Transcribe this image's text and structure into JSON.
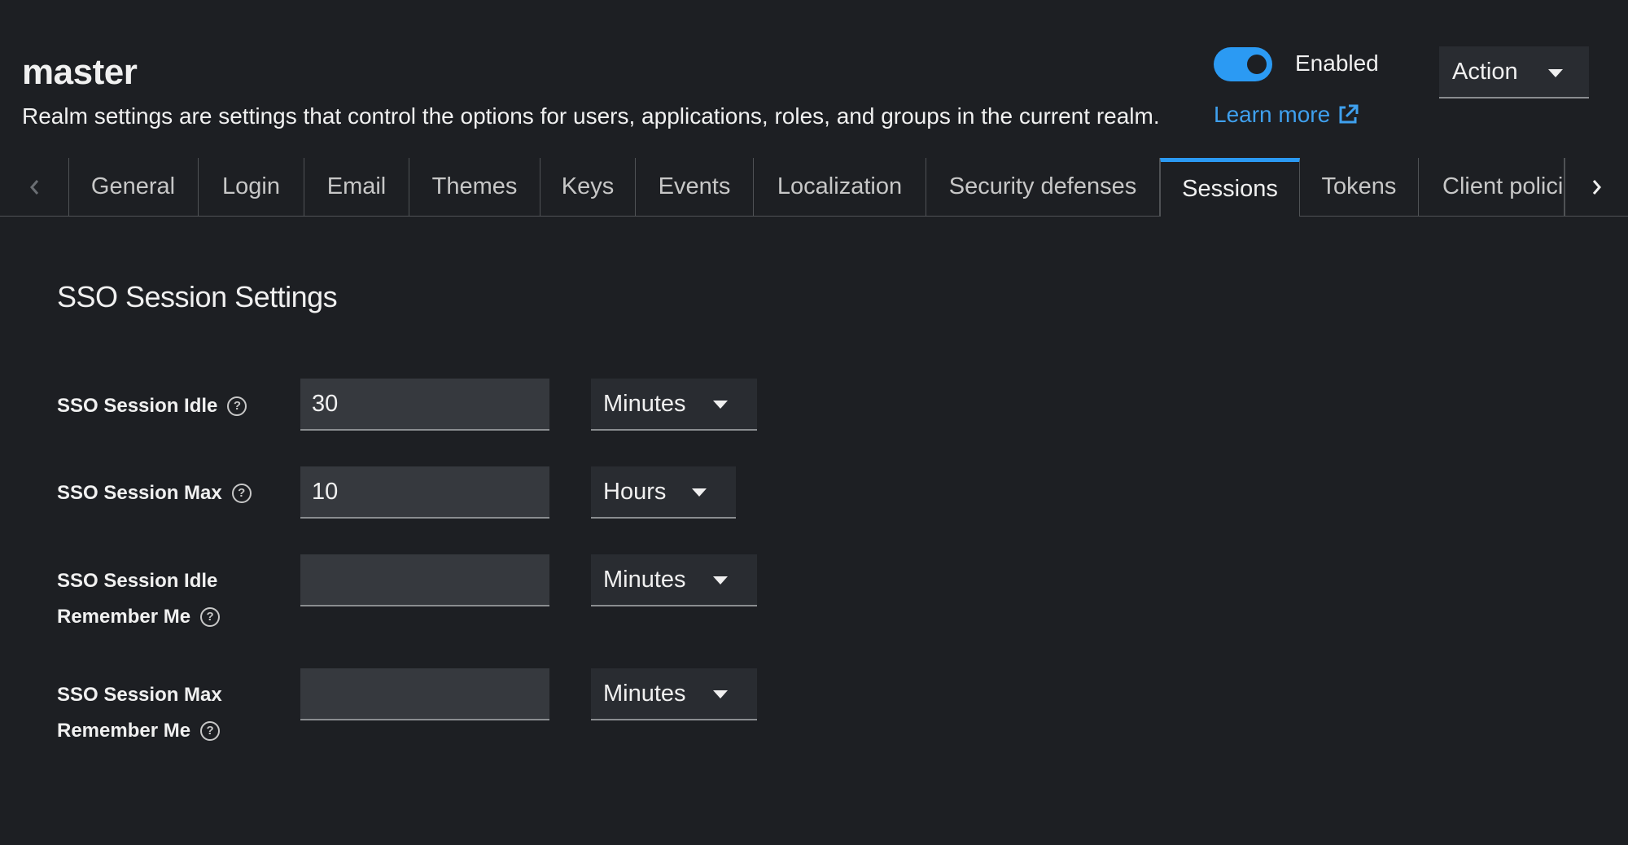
{
  "header": {
    "title": "master",
    "description": "Realm settings are settings that control the options for users, applications, roles, and groups in the current realm.",
    "learn_more": "Learn more",
    "enabled_label": "Enabled",
    "enabled": true,
    "action_label": "Action"
  },
  "tabs": [
    {
      "label": "General"
    },
    {
      "label": "Login"
    },
    {
      "label": "Email"
    },
    {
      "label": "Themes"
    },
    {
      "label": "Keys"
    },
    {
      "label": "Events"
    },
    {
      "label": "Localization"
    },
    {
      "label": "Security defenses"
    },
    {
      "label": "Sessions",
      "active": true
    },
    {
      "label": "Tokens"
    },
    {
      "label": "Client polici"
    }
  ],
  "section": {
    "title": "SSO Session Settings",
    "fields": [
      {
        "label_line1": "SSO Session Idle",
        "label_line2": "",
        "value": "30",
        "unit": "Minutes"
      },
      {
        "label_line1": "SSO Session Max",
        "label_line2": "",
        "value": "10",
        "unit": "Hours"
      },
      {
        "label_line1": "SSO Session Idle",
        "label_line2": "Remember Me",
        "value": "",
        "unit": "Minutes"
      },
      {
        "label_line1": "SSO Session Max",
        "label_line2": "Remember Me",
        "value": "",
        "unit": "Minutes"
      }
    ]
  },
  "icons": {
    "help": "?",
    "external_link": "external-link-icon",
    "scroll_left": "chevron-left-icon",
    "scroll_right": "chevron-right-icon"
  },
  "colors": {
    "accent": "#2b9af3",
    "link": "#3fa0ee",
    "background": "#1d1f23"
  }
}
